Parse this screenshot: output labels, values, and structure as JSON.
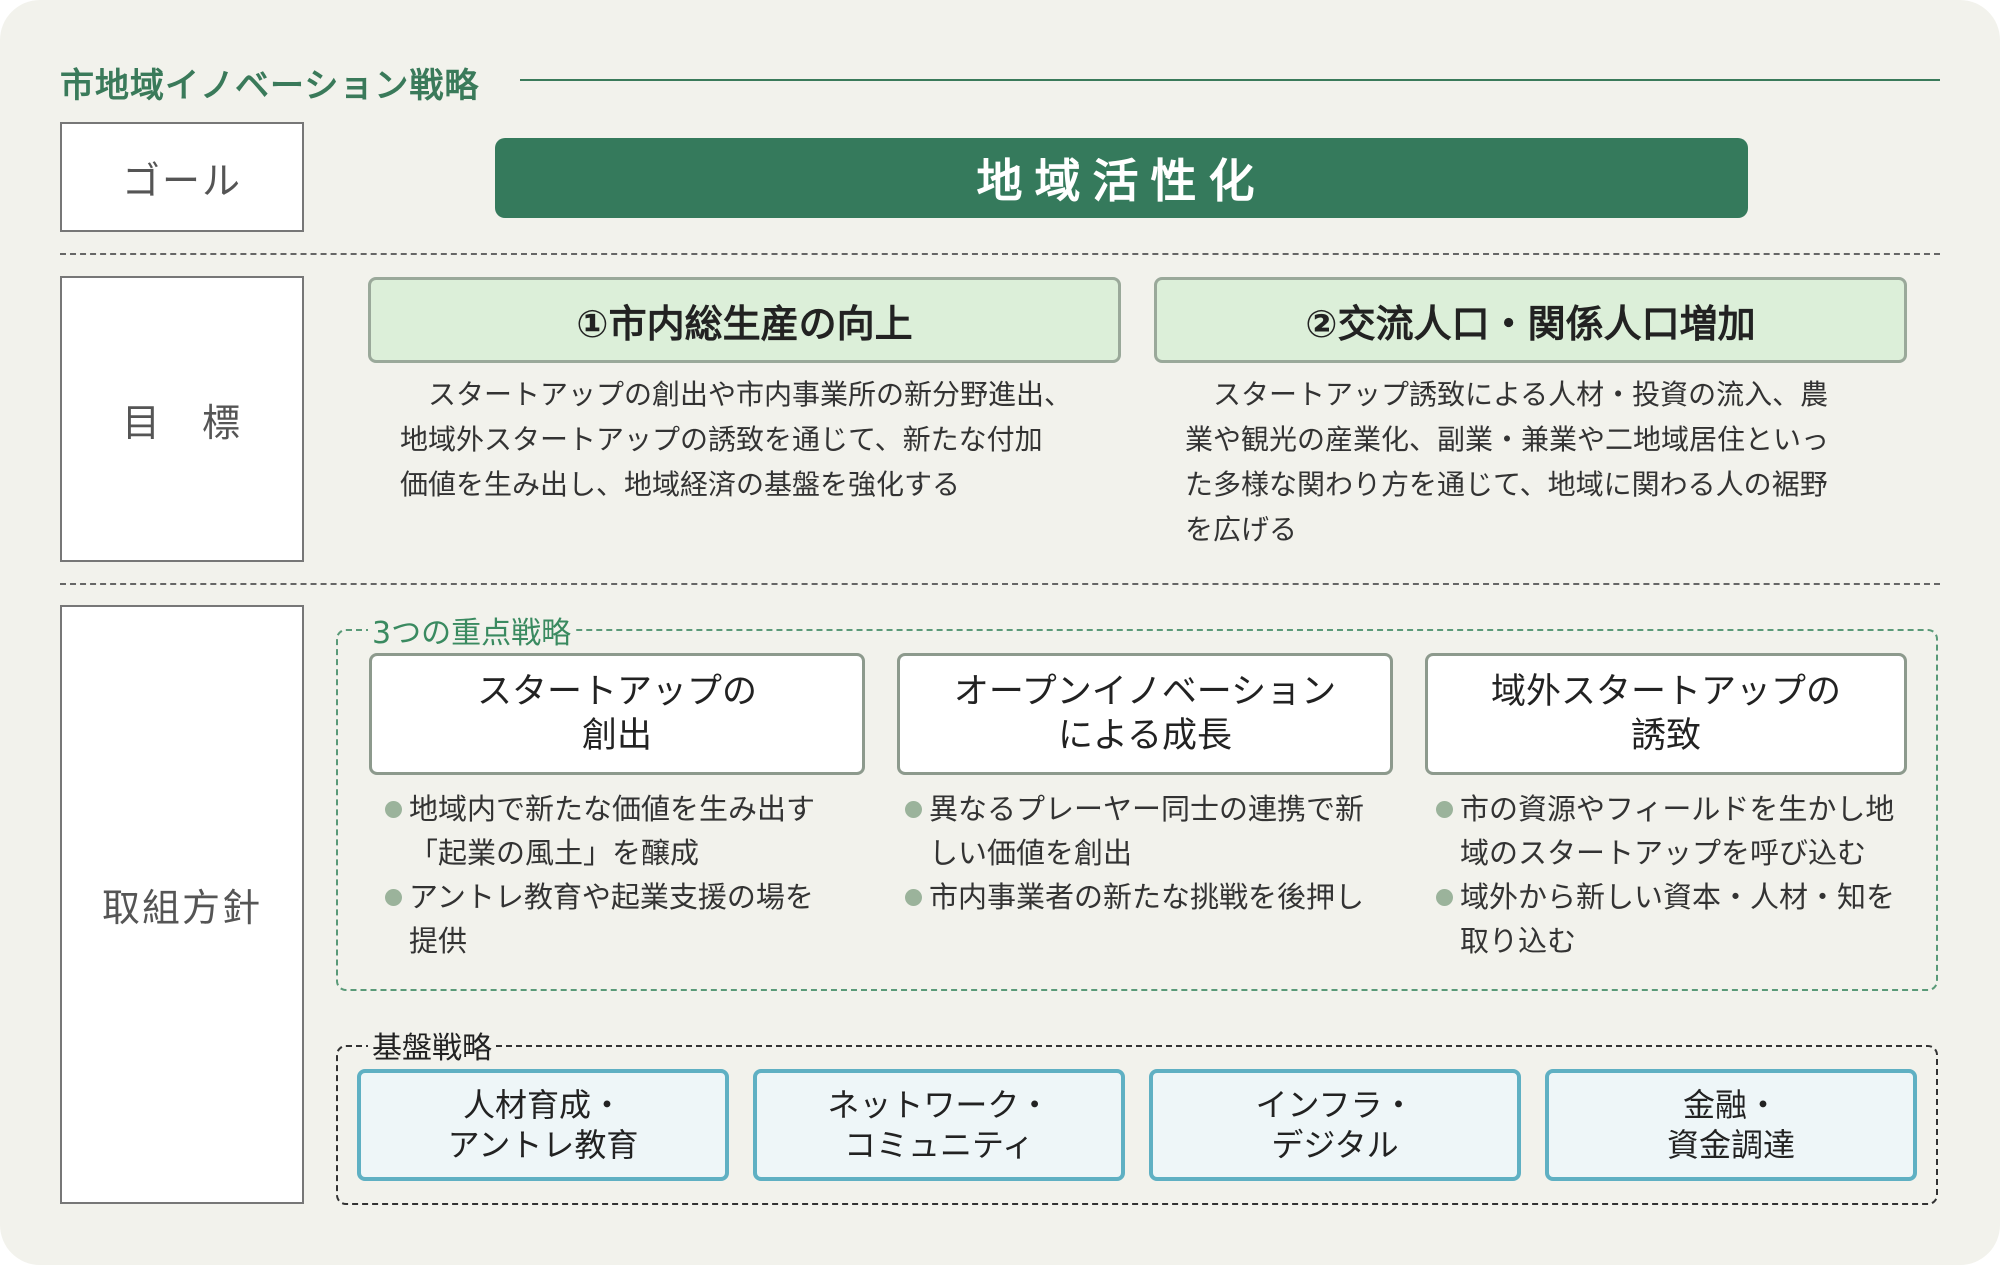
{
  "title": "市地域イノベーション戦略",
  "goal": {
    "label": "ゴール",
    "value": "地域活性化"
  },
  "objectives": {
    "label": "目　標",
    "items": [
      {
        "heading": "①市内総生産の向上",
        "lines": [
          "　スタートアップの創出や市内事業所の新分野進出、",
          "地域外スタートアップの誘致を通じて、新たな付加",
          "価値を生み出し、地域経済の基盤を強化する"
        ]
      },
      {
        "heading": "②交流人口・関係人口増加",
        "lines": [
          "　スタートアップ誘致による人材・投資の流入、農",
          "業や観光の産業化、副業・兼業や二地域居住といっ",
          "た多様な関わり方を通じて、地域に関わる人の裾野",
          "を広げる"
        ]
      }
    ]
  },
  "policy": {
    "label": "取組方針",
    "key_strategies": {
      "label": "3つの重点戦略",
      "items": [
        {
          "title_lines": [
            "スタートアップの",
            "創出"
          ],
          "bullets": [
            [
              "地域内で新たな価値を生み出す",
              "「起業の風土」を醸成"
            ],
            [
              "アントレ教育や起業支援の場を",
              "提供"
            ]
          ]
        },
        {
          "title_lines": [
            "オープンイノベーション",
            "による成長"
          ],
          "bullets": [
            [
              "異なるプレーヤー同士の連携で新",
              "しい価値を創出"
            ],
            [
              "市内事業者の新たな挑戦を後押し"
            ]
          ]
        },
        {
          "title_lines": [
            "域外スタートアップの",
            "誘致"
          ],
          "bullets": [
            [
              "市の資源やフィールドを生かし地",
              "域のスタートアップを呼び込む"
            ],
            [
              "域外から新しい資本・人材・知を",
              "取り込む"
            ]
          ]
        }
      ]
    },
    "base_strategies": {
      "label": "基盤戦略",
      "items": [
        [
          "人材育成・",
          "アントレ教育"
        ],
        [
          "ネットワーク・",
          "コミュニティ"
        ],
        [
          "インフラ・",
          "デジタル"
        ],
        [
          "金融・",
          "資金調達"
        ]
      ]
    }
  }
}
